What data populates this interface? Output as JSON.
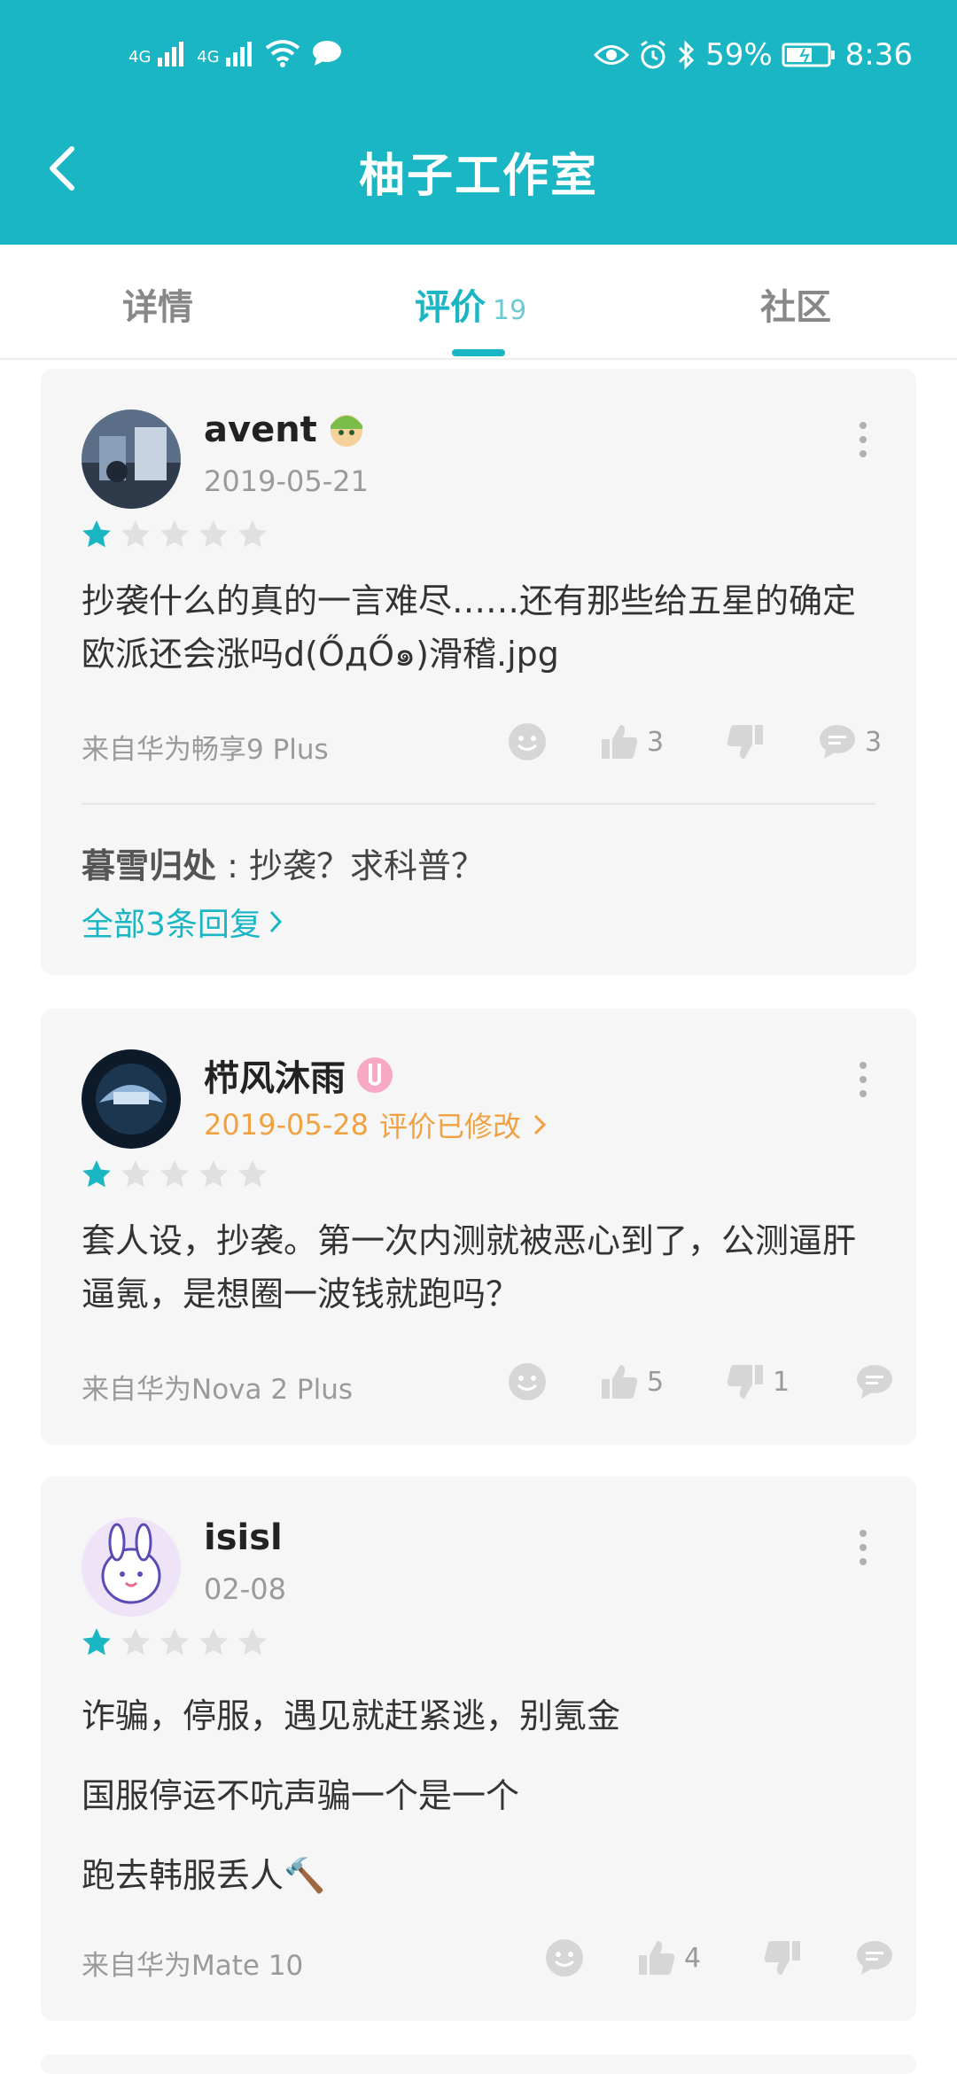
{
  "status_bar": {
    "battery": "59%",
    "time": "8:36",
    "net1": "4G",
    "net2": "4G"
  },
  "header": {
    "title": "柚子工作室"
  },
  "tabs": [
    {
      "label": "详情"
    },
    {
      "label": "评价",
      "count": "19"
    },
    {
      "label": "社区"
    }
  ],
  "reviews": [
    {
      "user": "avent",
      "date": "2019-05-21",
      "rating": 1,
      "content": [
        "抄袭什么的真的一言难尽……还有那些给五星的确定欧派还会涨吗d(ŐдŐ๑)滑稽.jpg"
      ],
      "device": "来自华为畅享9 Plus",
      "likes": "3",
      "dislikes": "",
      "comments": "3",
      "reply": {
        "user": "暮雪归处",
        "sep": " : ",
        "text": "抄袭？求科普？"
      },
      "all_replies": "全部3条回复"
    },
    {
      "user": "栉风沐雨",
      "date": "2019-05-28",
      "edited": "评价已修改",
      "rating": 1,
      "content": [
        "套人设，抄袭。第一次内测就被恶心到了，公测逼肝逼氪，是想圈一波钱就跑吗？"
      ],
      "device": "来自华为Nova 2 Plus",
      "likes": "5",
      "dislikes": "1",
      "comments": ""
    },
    {
      "user": "isisl",
      "date": "02-08",
      "rating": 1,
      "content": [
        "诈骗，停服，遇见就赶紧逃，别氪金",
        "国服停运不吭声骗一个是一个",
        "跑去韩服丢人🔨"
      ],
      "device": "来自华为Mate 10",
      "likes": "4",
      "dislikes": "",
      "comments": ""
    }
  ],
  "colors": {
    "brand": "#1ab6c4",
    "edited": "#f0a243",
    "star_on": "#1ab6c4",
    "star_off": "#e0e0e0"
  }
}
